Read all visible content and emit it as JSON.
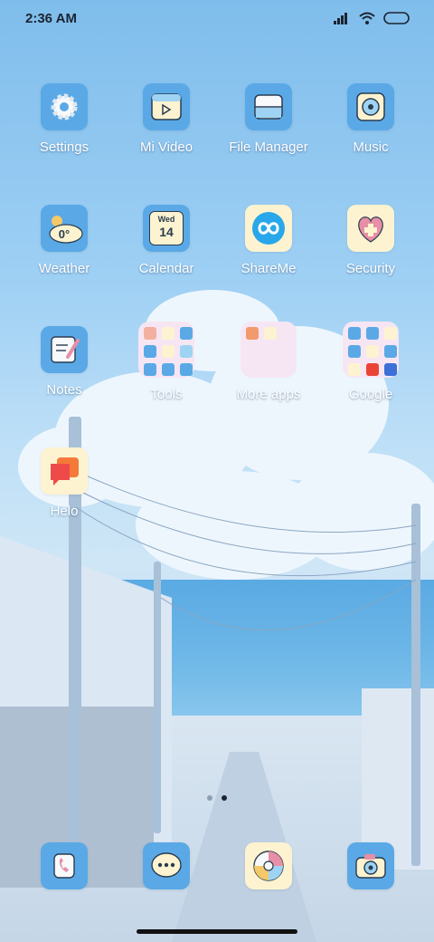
{
  "status_bar": {
    "time": "2:36 AM",
    "icons": [
      "signal-icon",
      "wifi-icon",
      "battery-icon"
    ]
  },
  "apps": {
    "settings": {
      "label": "Settings",
      "icon": "settings-gear-icon"
    },
    "mi_video": {
      "label": "Mi Video",
      "icon": "mi-video-icon"
    },
    "file_manager": {
      "label": "File Manager",
      "icon": "file-manager-icon"
    },
    "music": {
      "label": "Music",
      "icon": "music-speaker-icon"
    },
    "weather": {
      "label": "Weather",
      "icon": "weather-icon",
      "temperature": "0°"
    },
    "calendar": {
      "label": "Calendar",
      "icon": "calendar-icon",
      "day": "Wed",
      "date": "14"
    },
    "shareme": {
      "label": "ShareMe",
      "icon": "shareme-icon"
    },
    "security": {
      "label": "Security",
      "icon": "security-heart-icon"
    },
    "notes": {
      "label": "Notes",
      "icon": "notes-icon"
    },
    "tools": {
      "label": "Tools",
      "icon": "folder-icon"
    },
    "more_apps": {
      "label": "More apps",
      "icon": "folder-icon"
    },
    "google": {
      "label": "Google",
      "icon": "folder-icon"
    },
    "helo": {
      "label": "Helo",
      "icon": "helo-icon"
    }
  },
  "page_indicator": {
    "pages": 2,
    "current": 2
  },
  "dock": [
    "phone-icon",
    "messaging-icon",
    "browser-icon",
    "camera-icon"
  ],
  "colors": {
    "sky_top": "#7fbdec",
    "icon_blue": "#5aa9e6",
    "icon_cream": "#fdf3d0",
    "folder_pink": "#f6e6f4",
    "label_text": "#ffffff"
  }
}
